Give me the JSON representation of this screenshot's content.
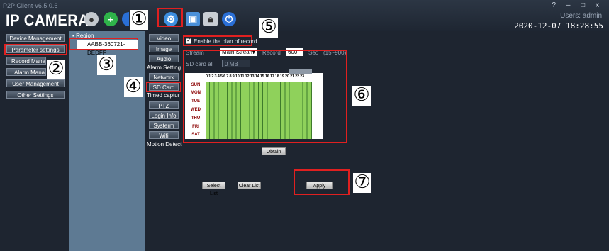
{
  "window": {
    "version": "P2P Client-v6.5.0.6",
    "app_title": "IP CAMERA",
    "controls": "? – □ x",
    "users": "Users: admin",
    "datetime": "2020-12-07 18:28:55"
  },
  "callouts": [
    "①",
    "②",
    "③",
    "④",
    "⑤",
    "⑥",
    "⑦"
  ],
  "left_nav": [
    "Device Management",
    "Parameter settings",
    "Record Manage",
    "Alarm Manage",
    "User Management",
    "Other Settings"
  ],
  "tree": {
    "root": "Region",
    "device": "AABB-360721-DEDFF"
  },
  "settings_nav": [
    "Video",
    "Image",
    "Audio",
    "Alarm Setting",
    "Network",
    "SD Card",
    "Timed captur",
    "PTZ",
    "Login Info",
    "Systerm",
    "Wifi",
    "Motion Detectio"
  ],
  "record": {
    "enable_label": "Enable the plan of record",
    "stream_label": "Stream",
    "stream_value": "Main Stream",
    "record_label": "Record",
    "record_value": "600",
    "sec_label": "Sec",
    "range": "(15~900)",
    "sdcard_label": "SD card all",
    "sdcard_value": "0 MB",
    "hours": "0 1 2 3 4 5 6 7 8 9 10 11 12 13 14 15 16 17 18 19 20 21 22 23",
    "days": [
      "SUN",
      "MON",
      "TUE",
      "WED",
      "THU",
      "FRI",
      "SAT"
    ]
  },
  "buttons": {
    "obtain": "Obtain",
    "select_list": "Select List",
    "clear_list": "Clear List",
    "apply": "Apply"
  }
}
